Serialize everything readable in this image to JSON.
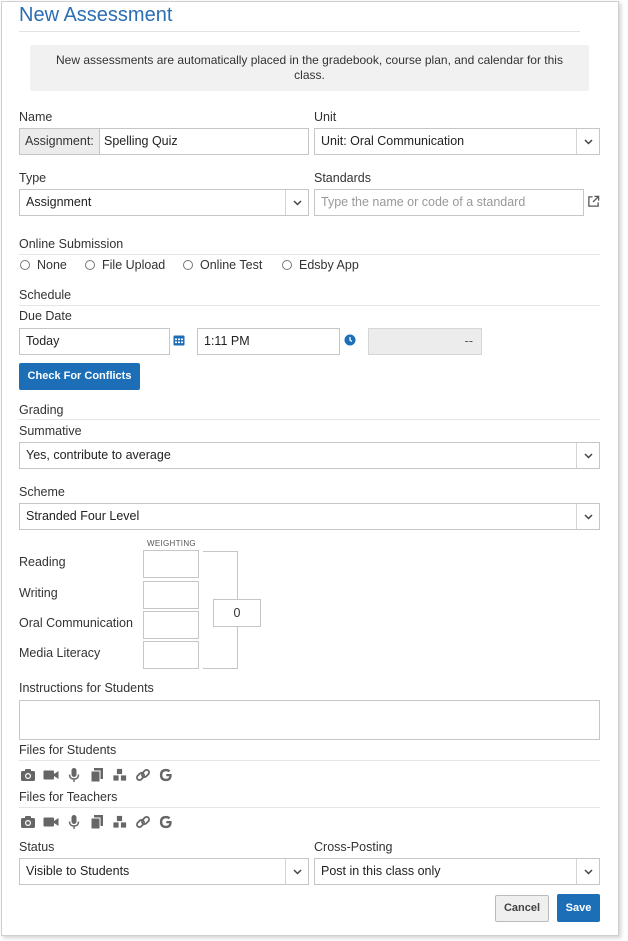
{
  "header": {
    "title": "New Assessment"
  },
  "notice": {
    "text": "New assessments are automatically placed in the gradebook, course plan, and calendar for this class."
  },
  "name": {
    "label": "Name",
    "prefix": "Assignment:",
    "value": "Spelling Quiz"
  },
  "unit": {
    "label": "Unit",
    "value": "Unit: Oral Communication"
  },
  "type": {
    "label": "Type",
    "value": "Assignment"
  },
  "standards": {
    "label": "Standards",
    "placeholder": "Type the name or code of a standard"
  },
  "online_submission": {
    "label": "Online Submission",
    "options": [
      "None",
      "File Upload",
      "Online Test",
      "Edsby App"
    ]
  },
  "schedule": {
    "label": "Schedule",
    "due_date_label": "Due Date",
    "date_value": "Today",
    "time_value": "1:11 PM",
    "duration_value": "--",
    "conflicts_button": "Check For Conflicts"
  },
  "grading": {
    "label": "Grading",
    "summative_label": "Summative",
    "summative_value": "Yes, contribute to average",
    "scheme_label": "Scheme",
    "scheme_value": "Stranded Four Level",
    "weighting_header": "WEIGHTING",
    "strands": [
      "Reading",
      "Writing",
      "Oral Communication",
      "Media Literacy"
    ],
    "total": "0"
  },
  "instructions": {
    "label": "Instructions for Students"
  },
  "files_students": {
    "label": "Files for Students"
  },
  "files_teachers": {
    "label": "Files for Teachers"
  },
  "status": {
    "label": "Status",
    "value": "Visible to Students"
  },
  "cross_posting": {
    "label": "Cross-Posting",
    "value": "Post in this class only"
  },
  "footer": {
    "cancel": "Cancel",
    "save": "Save"
  },
  "colors": {
    "accent": "#1c6fb7",
    "title": "#2a6eb4"
  },
  "icons": [
    "camera-icon",
    "video-icon",
    "microphone-icon",
    "copy-icon",
    "cubes-icon",
    "link-icon",
    "google-icon"
  ]
}
